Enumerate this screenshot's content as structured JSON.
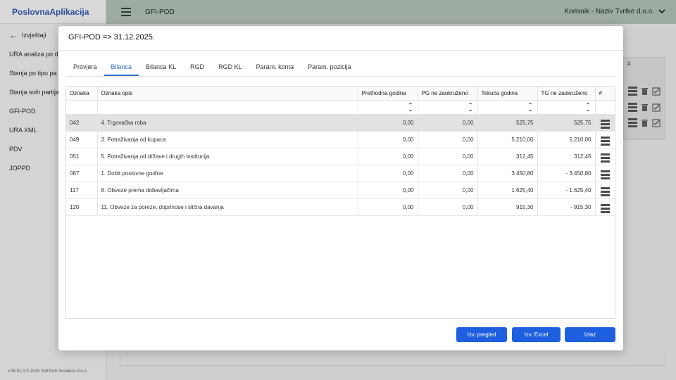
{
  "app": {
    "brand": "PoslovnaAplikacija",
    "top_title": "GFI-POD",
    "user": "Korisnik - Naziv Tvrtke d.o.o.",
    "version": "v.08.51.0 © 2025 SoftTech Solutions d.o.o."
  },
  "sidebar": {
    "back_label": "Izvještaji",
    "items": [
      "URA analiza po d",
      "Stanja po tipu pa",
      "Stanja svih partija",
      "GFI-POD",
      "URA XML",
      "PDV",
      "JOPPD"
    ]
  },
  "background_grid": {
    "hash": "#"
  },
  "modal": {
    "title": "GFI-POD => 31.12.2025.",
    "tabs": [
      "Provjera",
      "Bilanca",
      "Bilanca KL",
      "RGD",
      "RGD KL",
      "Param. konta",
      "Param. pozicija"
    ],
    "active_tab": "Bilanca",
    "table": {
      "columns": [
        "Oznaka",
        "Oznaka opis",
        "Prethodna godina",
        "PG ne zaokruženo",
        "Tekuća godina",
        "TG ne zaokruženo",
        "#"
      ],
      "rows": [
        [
          "042",
          "4. Trgovačka roba",
          "0,00",
          "0,00",
          "525,75",
          "525,75"
        ],
        [
          "049",
          "3. Potraživanja od kupaca",
          "0,00",
          "0,00",
          "5.210,00",
          "5.210,00"
        ],
        [
          "051",
          "5. Potraživanja od države i drugih institucija",
          "0,00",
          "0,00",
          "312,45",
          "312,45"
        ],
        [
          "087",
          "1. Dobit poslovne godine",
          "0,00",
          "0,00",
          "3.450,80",
          "- 3.450,80"
        ],
        [
          "117",
          "8. Obveze prema dobavljačima",
          "0,00",
          "0,00",
          "1.625,40",
          "- 1.625,40"
        ],
        [
          "120",
          "11. Obveze za poreze, doprinose i slična davanja",
          "0,00",
          "0,00",
          "915,30",
          "- 915,30"
        ]
      ]
    },
    "buttons": {
      "preview": "Izv. pregled",
      "excel": "Izv. Excel",
      "exit": "Izlaz"
    }
  },
  "colors": {
    "accent": "#1e5fe0",
    "tab_active": "#2d6ecb",
    "topbar": "#9eaba3",
    "brand": "#2b4e9b",
    "selected_row": "#e2e2e2"
  },
  "icons": [
    "arrow-left-icon",
    "hamburger-icon",
    "chevron-down-icon",
    "sort-icon",
    "list-icon",
    "trash-icon",
    "checkbox-icon"
  ]
}
